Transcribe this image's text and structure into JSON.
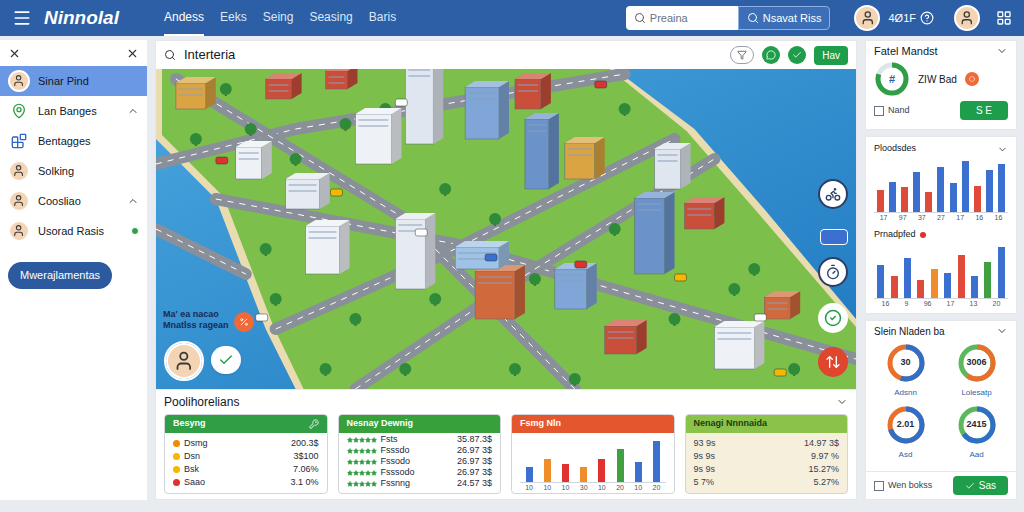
{
  "app": {
    "logo": "Ninnolal"
  },
  "nav": [
    {
      "label": "Andess",
      "selected": true
    },
    {
      "label": "Eeks",
      "selected": false
    },
    {
      "label": "Seing",
      "selected": false
    },
    {
      "label": "Seasing",
      "selected": false
    },
    {
      "label": "Baris",
      "selected": false
    }
  ],
  "search": {
    "placeholder": "Preaina",
    "button": "Nsavat Riss"
  },
  "user": {
    "code": "4Ø1F"
  },
  "sidebar": {
    "items": [
      {
        "label": "Sinar Pind",
        "kind": "avatar",
        "selected": true,
        "expandable": false,
        "online": false
      },
      {
        "label": "Lan Banges",
        "kind": "pin",
        "selected": false,
        "expandable": true,
        "online": false
      },
      {
        "label": "Bentagges",
        "kind": "blocks",
        "selected": false,
        "expandable": false,
        "online": false
      },
      {
        "label": "Solking",
        "kind": "avatar",
        "selected": false,
        "expandable": false,
        "online": false
      },
      {
        "label": "Coosliao",
        "kind": "avatar",
        "selected": false,
        "expandable": true,
        "online": false
      },
      {
        "label": "Usorad Rasis",
        "kind": "avatar",
        "selected": false,
        "expandable": false,
        "online": true
      }
    ],
    "button": "Mwerajlamentas"
  },
  "main": {
    "title": "Interteria",
    "action": "Hav"
  },
  "map": {
    "labels": [
      "Ma' ea nacao",
      "Mnatlss ragean"
    ]
  },
  "summary": {
    "title": "Poolihorelians",
    "cards": [
      {
        "title": "Besyng",
        "kind": "list",
        "color": "#2f9e44",
        "rows": [
          {
            "label": "Dsmg",
            "value": "200.3$",
            "color": "#f08c00"
          },
          {
            "label": "Dsn",
            "value": "3$100",
            "color": "#f5b700"
          },
          {
            "label": "Bsk",
            "value": "7.06%",
            "color": "#f5b700"
          },
          {
            "label": "Saao",
            "value": "3.1 0%",
            "color": "#e03131"
          }
        ]
      },
      {
        "title": "Nesnay Dewnig",
        "kind": "stars",
        "color": "#37a03a",
        "rows": [
          {
            "label": "Fsts",
            "value": "35.87.3$",
            "stars": 5
          },
          {
            "label": "Fsssdo",
            "value": "26.97 3$",
            "stars": 5
          },
          {
            "label": "Fssodo",
            "value": "26.97 3$",
            "stars": 5
          },
          {
            "label": "Fsssodo",
            "value": "26.97 3$",
            "stars": 5
          },
          {
            "label": "Fssnng",
            "value": "24.57 3$",
            "stars": 5
          }
        ]
      },
      {
        "title": "Fsmg Nln",
        "kind": "chart",
        "color": "#e4572e",
        "bars": [
          {
            "value": 20,
            "color": "#3b6fd0"
          },
          {
            "value": 30,
            "color": "#f08c2a"
          },
          {
            "value": 24,
            "color": "#e03131"
          },
          {
            "value": 20,
            "color": "#f08c2a"
          },
          {
            "value": 30,
            "color": "#e03131"
          },
          {
            "value": 44,
            "color": "#40a040"
          },
          {
            "value": 26,
            "color": "#3b6fd0"
          },
          {
            "value": 55,
            "color": "#3b6fd0"
          }
        ],
        "ticks": [
          "10",
          "10",
          "10",
          "30",
          "10",
          "20",
          "10",
          "20"
        ]
      },
      {
        "title": "Nenagi Nnnnaida",
        "kind": "table",
        "color": "#8bc34a",
        "rows": [
          {
            "label": "93 9s",
            "value": "14.97 3$"
          },
          {
            "label": "9s 9s",
            "value": "9.97 %"
          },
          {
            "label": "9s 9s",
            "value": "15.27%"
          },
          {
            "label": "5 7%",
            "value": "5.27%"
          }
        ]
      }
    ]
  },
  "status": {
    "title": "Fatel Mandst",
    "donut": {
      "level": 0.8,
      "center": "#"
    },
    "label": "ZIW Bad",
    "checkbox": {
      "label": "Nand",
      "checked": false
    },
    "button": "S E"
  },
  "charts": [
    {
      "title": "Ploodsdes",
      "marker": false,
      "bars": [
        {
          "value": 30,
          "color": "#e04a3a"
        },
        {
          "value": 42,
          "color": "#3b6fd0"
        },
        {
          "value": 35,
          "color": "#e04a3a"
        },
        {
          "value": 55,
          "color": "#3b6fd0"
        },
        {
          "value": 28,
          "color": "#e04a3a"
        },
        {
          "value": 62,
          "color": "#3b6fd0"
        },
        {
          "value": 40,
          "color": "#3b6fd0"
        },
        {
          "value": 70,
          "color": "#3b6fd0"
        },
        {
          "value": 36,
          "color": "#e04a3a"
        },
        {
          "value": 58,
          "color": "#3b6fd0"
        },
        {
          "value": 66,
          "color": "#3b6fd0"
        }
      ],
      "ticks": [
        "17",
        "97",
        "37",
        "27",
        "17",
        "16",
        "16"
      ]
    },
    {
      "title": "Prnadpfed",
      "marker": true,
      "bars": [
        {
          "value": 45,
          "color": "#3b6fd0"
        },
        {
          "value": 30,
          "color": "#e04a3a"
        },
        {
          "value": 55,
          "color": "#3b6fd0"
        },
        {
          "value": 25,
          "color": "#e04a3a"
        },
        {
          "value": 40,
          "color": "#f08c2a"
        },
        {
          "value": 35,
          "color": "#3b6fd0"
        },
        {
          "value": 60,
          "color": "#e04a3a"
        },
        {
          "value": 30,
          "color": "#3b6fd0"
        },
        {
          "value": 50,
          "color": "#40a040"
        },
        {
          "value": 70,
          "color": "#3b6fd0"
        }
      ],
      "ticks": [
        "16",
        "9",
        "96",
        "17",
        "13",
        "20"
      ]
    }
  ],
  "gauges": {
    "title": "Slein Nladen ba",
    "items": [
      {
        "value": "30",
        "label": "Adsnn",
        "level": 0.55,
        "color": "#2f6fc8",
        "track": "#e8702a"
      },
      {
        "value": "3006",
        "label": "Lolesatp",
        "level": 0.6,
        "color": "#e8702a",
        "track": "#5cb85c"
      },
      {
        "value": "2.01",
        "label": "Asd",
        "level": 0.7,
        "color": "#2f6fc8",
        "track": "#e8702a"
      },
      {
        "value": "2415",
        "label": "Aad",
        "level": 0.65,
        "color": "#2f6fc8",
        "track": "#5cb85c"
      }
    ],
    "checkbox": {
      "label": "Wen bokss",
      "checked": false
    },
    "button": "Sas"
  }
}
